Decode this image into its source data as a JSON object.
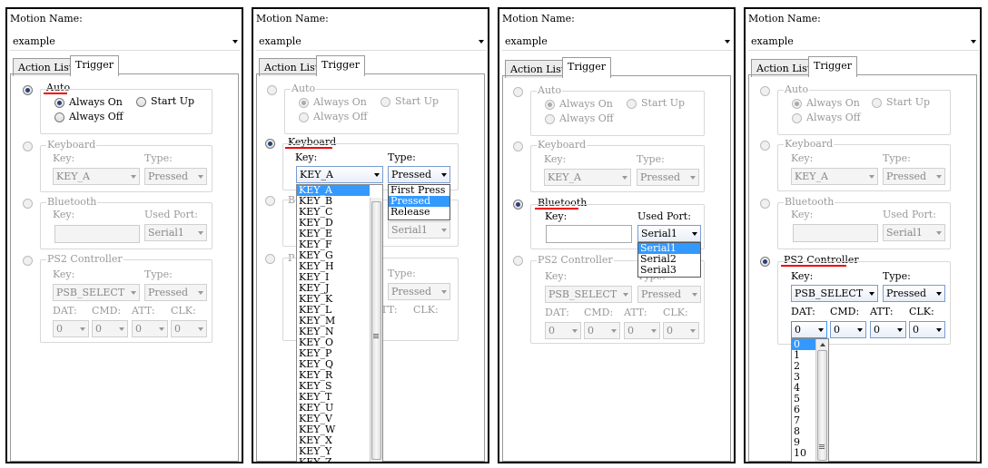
{
  "panels": [
    {
      "motion_name_label": "Motion Name:",
      "motion_name_value": "example",
      "tabs": [
        {
          "label": "Action List"
        },
        {
          "label": "Trigger"
        }
      ],
      "auto": {
        "label": "Auto",
        "always_on": "Always On",
        "start_up": "Start Up",
        "always_off": "Always Off"
      },
      "keyboard": {
        "label": "Keyboard",
        "key_label": "Key:",
        "key_value": "KEY_A",
        "type_label": "Type:",
        "type_value": "Pressed"
      },
      "bluetooth": {
        "label": "Bluetooth",
        "key_label": "Key:",
        "port_label": "Used Port:",
        "port_value": "Serial1"
      },
      "ps2": {
        "label": "PS2 Controller",
        "key_label": "Key:",
        "key_value": "PSB_SELECT",
        "type_label": "Type:",
        "type_value": "Pressed",
        "dat_label": "DAT:",
        "cmd_label": "CMD:",
        "att_label": "ATT:",
        "clk_label": "CLK:",
        "dat_value": "0",
        "cmd_value": "0",
        "att_value": "0",
        "clk_value": "0"
      }
    },
    {
      "motion_name_label": "Motion Name:",
      "motion_name_value": "example",
      "tabs": [
        {
          "label": "Action List"
        },
        {
          "label": "Trigger"
        }
      ],
      "auto": {
        "label": "Auto",
        "always_on": "Always On",
        "start_up": "Start Up",
        "always_off": "Always Off"
      },
      "keyboard": {
        "label": "Keyboard",
        "key_label": "Key:",
        "key_value": "KEY_A",
        "type_label": "Type:",
        "type_value": "Pressed"
      },
      "bluetooth": {
        "label_partial": "B",
        "port_value": "Serial1"
      },
      "ps2": {
        "label_partial": "P",
        "type_label": "Type:",
        "type_value": "Pressed",
        "att_label": "ATT:",
        "clk_label": "CLK:"
      },
      "key_dropdown": [
        "KEY_A",
        "KEY_B",
        "KEY_C",
        "KEY_D",
        "KEY_E",
        "KEY_F",
        "KEY_G",
        "KEY_H",
        "KEY_I",
        "KEY_J",
        "KEY_K",
        "KEY_L",
        "KEY_M",
        "KEY_N",
        "KEY_O",
        "KEY_P",
        "KEY_Q",
        "KEY_R",
        "KEY_S",
        "KEY_T",
        "KEY_U",
        "KEY_V",
        "KEY_W",
        "KEY_X",
        "KEY_Y",
        "KEY_Z"
      ],
      "type_dropdown": [
        "First Press",
        "Pressed",
        "Release"
      ]
    },
    {
      "motion_name_label": "Motion Name:",
      "motion_name_value": "example",
      "tabs": [
        {
          "label": "Action List"
        },
        {
          "label": "Trigger"
        }
      ],
      "auto": {
        "label": "Auto",
        "always_on": "Always On",
        "start_up": "Start Up",
        "always_off": "Always Off"
      },
      "keyboard": {
        "label": "Keyboard",
        "key_label": "Key:",
        "key_value": "KEY_A",
        "type_label": "Type:",
        "type_value": "Pressed"
      },
      "bluetooth": {
        "label": "Bluetooth",
        "key_label": "Key:",
        "port_label": "Used Port:",
        "port_value": "Serial1"
      },
      "ps2": {
        "label": "PS2 Controller",
        "key_label": "Key:",
        "key_value": "PSB_SELECT",
        "type_label": "Type:",
        "type_value": "Pressed",
        "dat_label": "DAT:",
        "cmd_label": "CMD:",
        "att_label": "ATT:",
        "clk_label": "CLK:",
        "dat_value": "0",
        "cmd_value": "0",
        "att_value": "0",
        "clk_value": "0"
      },
      "port_dropdown": [
        "Serial1",
        "Serial2",
        "Serial3"
      ]
    },
    {
      "motion_name_label": "Motion Name:",
      "motion_name_value": "example",
      "tabs": [
        {
          "label": "Action List"
        },
        {
          "label": "Trigger"
        }
      ],
      "auto": {
        "label": "Auto",
        "always_on": "Always On",
        "start_up": "Start Up",
        "always_off": "Always Off"
      },
      "keyboard": {
        "label": "Keyboard",
        "key_label": "Key:",
        "key_value": "KEY_A",
        "type_label": "Type:",
        "type_value": "Pressed"
      },
      "bluetooth": {
        "label": "Bluetooth",
        "key_label": "Key:",
        "port_label": "Used Port:",
        "port_value": "Serial1"
      },
      "ps2": {
        "label": "PS2 Controller",
        "key_label": "Key:",
        "key_value": "PSB_SELECT",
        "type_label": "Type:",
        "type_value": "Pressed",
        "dat_label": "DAT:",
        "cmd_label": "CMD:",
        "att_label": "ATT:",
        "clk_label": "CLK:",
        "dat_value": "0",
        "cmd_value": "0",
        "att_value": "0",
        "clk_value": "0"
      },
      "dat_dropdown": [
        "0",
        "1",
        "2",
        "3",
        "4",
        "5",
        "6",
        "7",
        "8",
        "9",
        "10"
      ]
    }
  ],
  "colors": {
    "highlight": "#3399ff",
    "underline": "#e00000",
    "radio_on": "#2a3f7a"
  }
}
